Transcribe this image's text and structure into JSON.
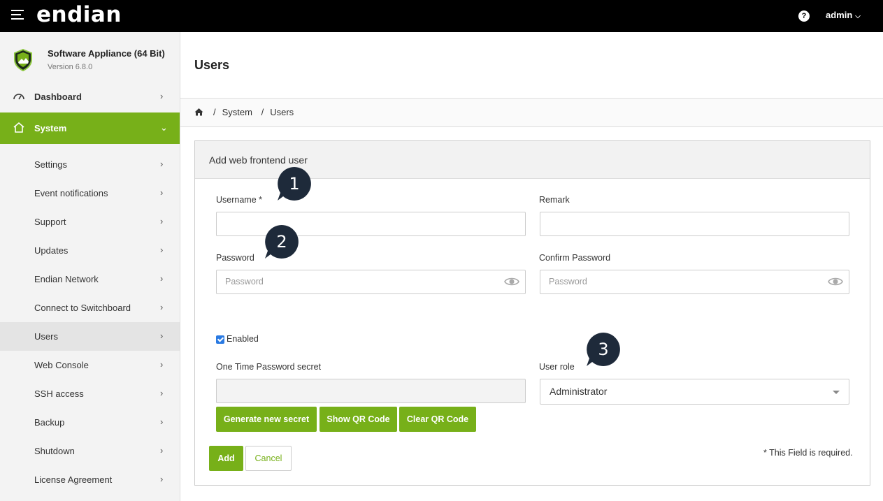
{
  "topbar": {
    "logo": "endian",
    "help": "?",
    "user": "admin"
  },
  "sidebar": {
    "product_name": "Software Appliance (64 Bit)",
    "version": "Version 6.8.0",
    "dashboard": "Dashboard",
    "system": "System",
    "items": [
      "Settings",
      "Event notifications",
      "Support",
      "Updates",
      "Endian Network",
      "Connect to Switchboard",
      "Users",
      "Web Console",
      "SSH access",
      "Backup",
      "Shutdown",
      "License Agreement"
    ],
    "selected_item": "Users"
  },
  "page": {
    "title": "Users",
    "breadcrumb": [
      "System",
      "Users"
    ]
  },
  "form": {
    "title": "Add web frontend user",
    "username_label": "Username *",
    "username_value": "",
    "remark_label": "Remark",
    "remark_value": "",
    "password_label": "Password",
    "password_placeholder": "Password",
    "confirm_label": "Confirm Password",
    "confirm_placeholder": "Password",
    "enabled_label": "Enabled",
    "enabled_checked": true,
    "otp_label": "One Time Password secret",
    "otp_value": "",
    "role_label": "User role",
    "role_value": "Administrator",
    "generate_button": "Generate new secret",
    "show_qr_button": "Show QR Code",
    "clear_qr_button": "Clear QR Code",
    "add_button": "Add",
    "cancel_button": "Cancel",
    "required_note": "* This Field is required."
  },
  "callouts": [
    "1",
    "2",
    "3"
  ],
  "colors": {
    "accent": "#77b019",
    "topbar": "#000000",
    "callout": "#1e2a3a",
    "checkbox": "#2a7ae2"
  }
}
